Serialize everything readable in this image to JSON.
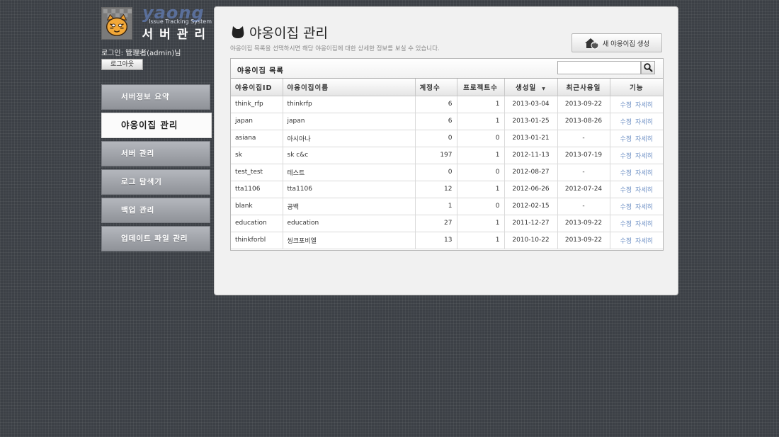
{
  "brand": {
    "word": "yaong",
    "subtitle": "Issue Tracking System",
    "title": "서버관리"
  },
  "login": {
    "text": "로그인: 管理者(admin)님",
    "logout_label": "로그아웃"
  },
  "nav": [
    {
      "label": "서버정보 요약",
      "active": false
    },
    {
      "label": "야옹이집 관리",
      "active": true
    },
    {
      "label": "서버 관리",
      "active": false
    },
    {
      "label": "로그 탐색기",
      "active": false
    },
    {
      "label": "백업 관리",
      "active": false
    },
    {
      "label": "업데이트 파일 관리",
      "active": false
    }
  ],
  "main": {
    "title": "야옹이집 관리",
    "description": "야옹이집 목록을 선택하시면 해당 야옹이집에 대한 상세한 정보를 보실 수 있습니다.",
    "new_button_label": "새 야옹이집 생성",
    "list_title": "야옹이집 목록",
    "search": {
      "value": "",
      "placeholder": ""
    },
    "columns": [
      "야옹이집ID",
      "야옹이집이름",
      "계정수",
      "프로젝트수",
      "생성일",
      "최근사용일",
      "기능"
    ],
    "rows": [
      {
        "id": "think_rfp",
        "name": "thinkrfp",
        "accounts": "6",
        "projects": "1",
        "created": "2013-03-04",
        "last_used": "2013-09-22"
      },
      {
        "id": "japan",
        "name": "japan",
        "accounts": "6",
        "projects": "1",
        "created": "2013-01-25",
        "last_used": "2013-08-26"
      },
      {
        "id": "asiana",
        "name": "아시아나",
        "accounts": "0",
        "projects": "0",
        "created": "2013-01-21",
        "last_used": "-"
      },
      {
        "id": "sk",
        "name": "sk c&c",
        "accounts": "197",
        "projects": "1",
        "created": "2012-11-13",
        "last_used": "2013-07-19"
      },
      {
        "id": "test_test",
        "name": "테스트",
        "accounts": "0",
        "projects": "0",
        "created": "2012-08-27",
        "last_used": "-"
      },
      {
        "id": "tta1106",
        "name": "tta1106",
        "accounts": "12",
        "projects": "1",
        "created": "2012-06-26",
        "last_used": "2012-07-24"
      },
      {
        "id": "blank",
        "name": "공백",
        "accounts": "1",
        "projects": "0",
        "created": "2012-02-15",
        "last_used": "-"
      },
      {
        "id": "education",
        "name": "education",
        "accounts": "27",
        "projects": "1",
        "created": "2011-12-27",
        "last_used": "2013-09-22"
      },
      {
        "id": "thinkforbl",
        "name": "씽크포비엘",
        "accounts": "13",
        "projects": "1",
        "created": "2010-10-22",
        "last_used": "2013-09-22"
      }
    ],
    "row_actions": {
      "edit": "수정",
      "detail": "자세히"
    }
  },
  "colors": {
    "accent_link": "#6c8fc4",
    "nav_inactive": "#9fa2a8",
    "background": "#3c4046"
  },
  "icons": [
    "cat-icon",
    "house-cat-icon",
    "search-icon",
    "yaong-logo"
  ]
}
